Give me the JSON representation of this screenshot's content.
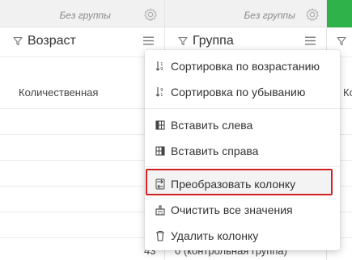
{
  "columns": [
    {
      "group_label": "Без группы",
      "title": "Возраст",
      "type_label": "Количественная"
    },
    {
      "group_label": "Без группы",
      "title": "Группа",
      "type_label": "",
      "bottom_text": "0 (контрольная группа)"
    },
    {
      "title": "",
      "type_label": "Ко"
    }
  ],
  "bottom_row_value": "43",
  "menu": {
    "items": [
      {
        "label": "Сортировка по возрастанию",
        "icon": "sort-ascending-icon"
      },
      {
        "label": "Сортировка по убыванию",
        "icon": "sort-descending-icon"
      },
      {
        "label": "Вставить слева",
        "icon": "insert-left-icon"
      },
      {
        "label": "Вставить справа",
        "icon": "insert-right-icon"
      },
      {
        "label": "Преобразовать колонку",
        "icon": "transform-column-icon"
      },
      {
        "label": "Очистить все значения",
        "icon": "clear-values-icon"
      },
      {
        "label": "Удалить колонку",
        "icon": "trash-icon"
      }
    ],
    "highlight_color": "#d32020"
  },
  "colors": {
    "accent_green": "#2fb24a",
    "header_bg": "#f1f1f1"
  }
}
